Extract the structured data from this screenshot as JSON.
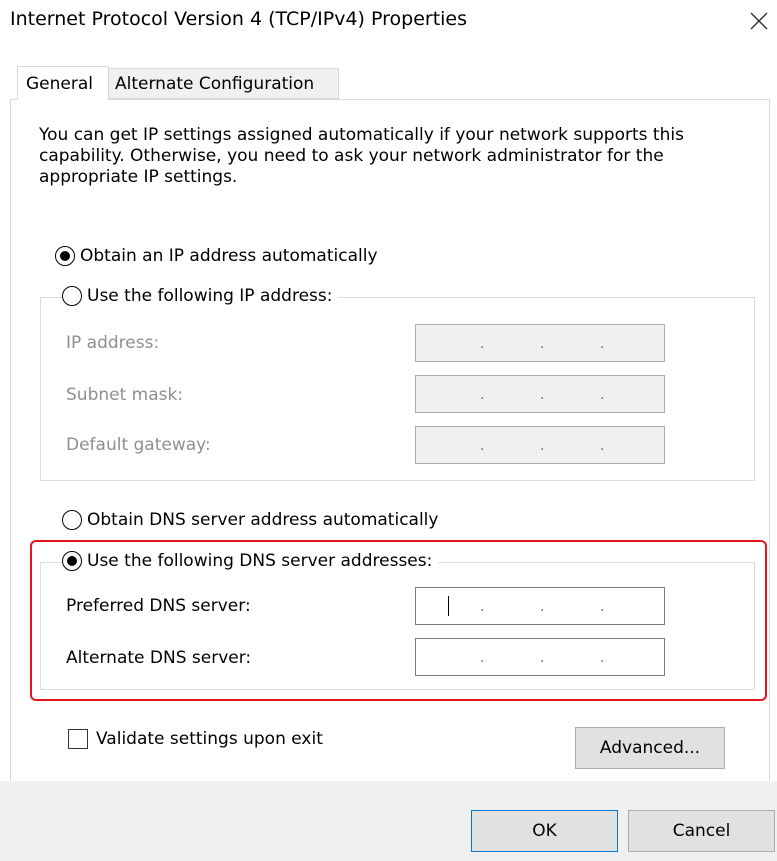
{
  "window": {
    "title": "Internet Protocol Version 4 (TCP/IPv4) Properties",
    "close_icon": "close-icon"
  },
  "tabs": [
    {
      "label": "General",
      "active": true
    },
    {
      "label": "Alternate Configuration",
      "active": false
    }
  ],
  "description": "You can get IP settings assigned automatically if your network supports this capability. Otherwise, you need to ask your network administrator for the appropriate IP settings.",
  "ip_section": {
    "auto_label": "Obtain an IP address automatically",
    "auto_selected": true,
    "manual_label": "Use the following IP address:",
    "manual_selected": false,
    "fields": [
      {
        "label": "IP address:",
        "value": ". . .",
        "enabled": false
      },
      {
        "label": "Subnet mask:",
        "value": ". . .",
        "enabled": false
      },
      {
        "label": "Default gateway:",
        "value": ". . .",
        "enabled": false
      }
    ]
  },
  "dns_section": {
    "auto_label": "Obtain DNS server address automatically",
    "auto_selected": false,
    "manual_label": "Use the following DNS server addresses:",
    "manual_selected": true,
    "fields": [
      {
        "label": "Preferred DNS server:",
        "value": ". . .",
        "enabled": true,
        "focused": true
      },
      {
        "label": "Alternate DNS server:",
        "value": ". . .",
        "enabled": true,
        "focused": false
      }
    ]
  },
  "validate": {
    "label": "Validate settings upon exit",
    "checked": false
  },
  "buttons": {
    "advanced": "Advanced...",
    "ok": "OK",
    "cancel": "Cancel"
  },
  "colors": {
    "highlight": "#e2161b",
    "default_button_border": "#0078d7",
    "disabled_text": "#8f8f8f",
    "dialog_footer": "#f0f0f0"
  }
}
